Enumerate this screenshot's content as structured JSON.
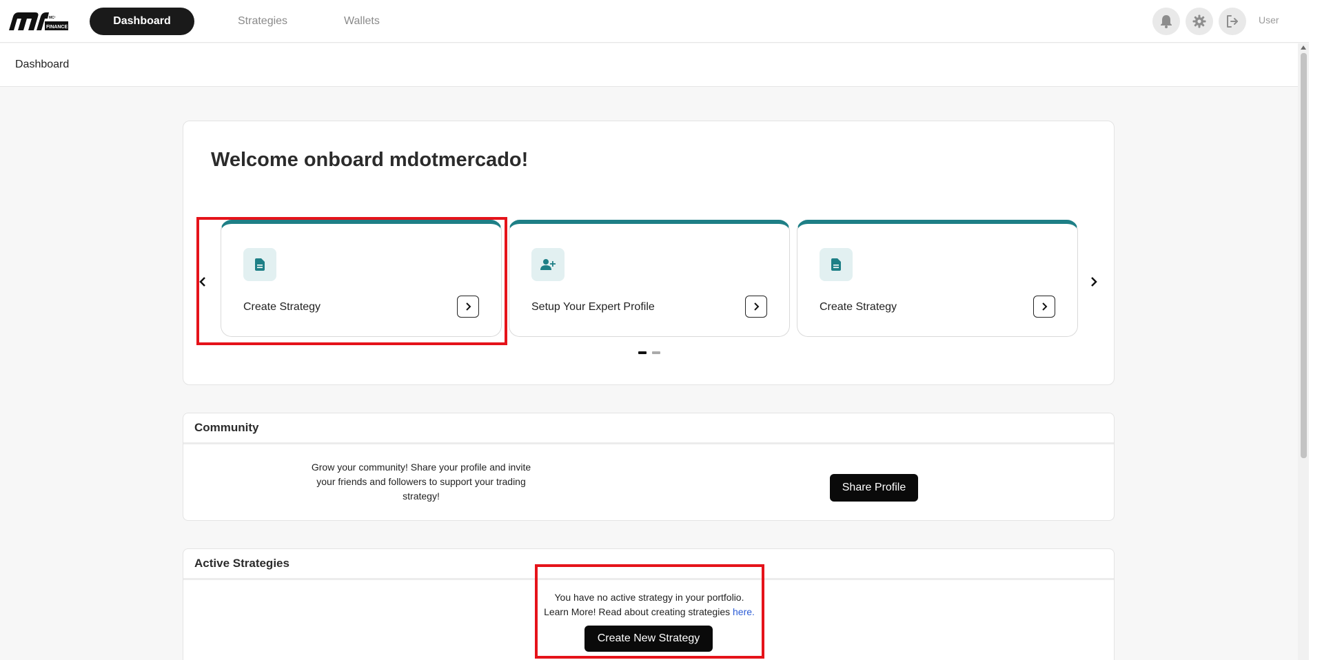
{
  "nav": {
    "logo_text": "MC² FINANCE",
    "tabs": [
      {
        "label": "Dashboard"
      },
      {
        "label": "Strategies"
      },
      {
        "label": "Wallets"
      }
    ],
    "user_label": "User",
    "icons": [
      "bell-icon",
      "gear-icon",
      "logout-icon"
    ]
  },
  "breadcrumb": {
    "label": "Dashboard"
  },
  "welcome": {
    "title": "Welcome onboard mdotmercado!",
    "cards": [
      {
        "label": "Create Strategy",
        "icon": "document-icon"
      },
      {
        "label": "Setup Your Expert Profile",
        "icon": "add-user-icon"
      },
      {
        "label": "Create Strategy",
        "icon": "document-icon"
      }
    ],
    "carousel": {
      "pages": 2,
      "active_page": 1
    }
  },
  "community": {
    "title": "Community",
    "text": "Grow your community! Share your profile and invite your friends and followers to support your trading strategy!",
    "button": "Share Profile"
  },
  "active_strategies": {
    "title": "Active Strategies",
    "line1": "You have no active strategy in your portfolio.",
    "line2": "Learn More! Read about creating strategies ",
    "link": "here.",
    "button": "Create New Strategy"
  },
  "colors": {
    "accent_teal": "#1e7f86",
    "highlight_red": "#e5131a",
    "dark": "#0a0a0a"
  }
}
